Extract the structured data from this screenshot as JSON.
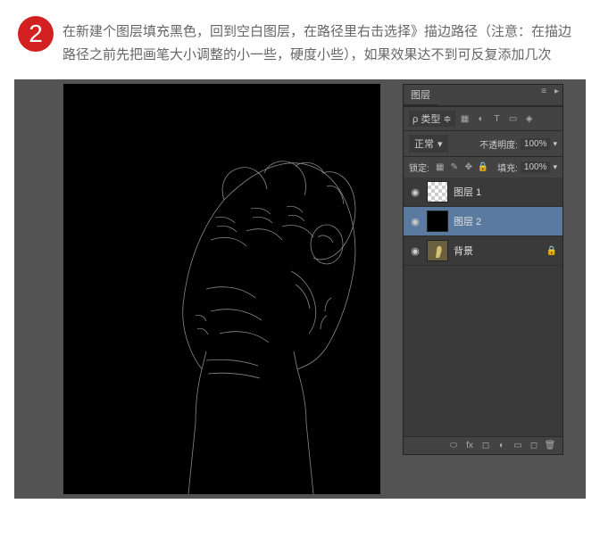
{
  "step": {
    "number": "2",
    "text": "在新建个图层填充黑色，回到空白图层，在路径里右击选择》描边路径（注意：在描边路径之前先把画笔大小调整的小一些，硬度小些），如果效果达不到可反复添加几次"
  },
  "panel": {
    "title": "图层",
    "type_label": "类型",
    "type_value": "≡",
    "blend_mode": "正常",
    "opacity_label": "不透明度:",
    "opacity_value": "100%",
    "lock_label": "锁定:",
    "fill_label": "填充:",
    "fill_value": "100%"
  },
  "layers": [
    {
      "name": "图层 1",
      "thumb_type": "transparent",
      "selected": false,
      "locked": false
    },
    {
      "name": "图层 2",
      "thumb_type": "black",
      "selected": true,
      "locked": false
    },
    {
      "name": "背景",
      "thumb_type": "bg",
      "selected": false,
      "locked": true
    }
  ],
  "icons": {
    "close": "×",
    "menu": "≡",
    "eye": "👁",
    "lock": "🔒",
    "dropdown": "▾"
  }
}
